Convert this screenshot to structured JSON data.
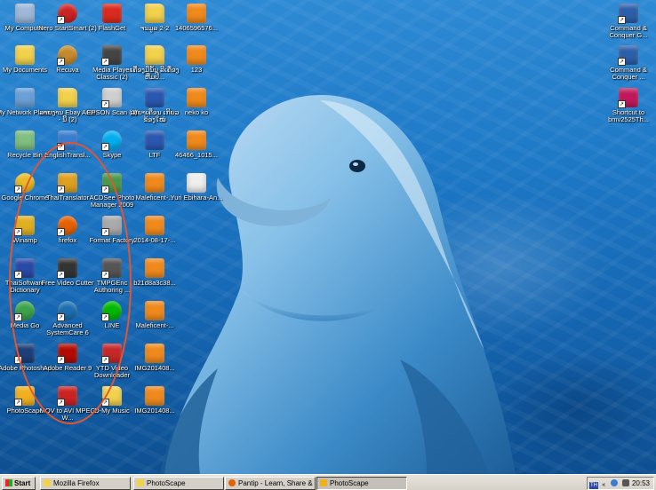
{
  "desktop": {
    "icons": [
      {
        "label": "My Computer",
        "icon": "my-computer-icon",
        "color": "#9fb8d8",
        "shortcut": false
      },
      {
        "label": "Nero StartSmart (2)",
        "icon": "nero-icon",
        "color": "#cc2222",
        "shortcut": true
      },
      {
        "label": "FlashGet",
        "icon": "flashget-icon",
        "color": "#d92b1e",
        "shortcut": false
      },
      {
        "label": "ຈນມູລ 2-2",
        "icon": "folder-icon",
        "color": "#f2d14b",
        "shortcut": false
      },
      {
        "label": "1406596576...",
        "icon": "photoscape-file-icon",
        "color": "#f08a1c",
        "shortcut": false
      },
      {
        "label": "Command & Conquer G...",
        "icon": "command-conquer-icon",
        "color": "#2c5faa",
        "shortcut": true
      },
      {
        "label": "My Documents",
        "icon": "my-documents-icon",
        "color": "#f2d14b",
        "shortcut": false
      },
      {
        "label": "Recuva",
        "icon": "recuva-icon",
        "color": "#c58a2a",
        "shortcut": true
      },
      {
        "label": "Media Player Classic (2)",
        "icon": "media-player-classic-icon",
        "color": "#444444",
        "shortcut": true
      },
      {
        "label": "ເຄື່ອງມືນັ້ນ ລີເຄື່ອງຫືມປີ...",
        "icon": "folder-icon",
        "color": "#f2d14b",
        "shortcut": false
      },
      {
        "label": "123",
        "icon": "photoscape-file-icon",
        "color": "#f08a1c",
        "shortcut": false
      },
      {
        "label": "Command & Conquer ...",
        "icon": "command-conquer-icon",
        "color": "#2c5faa",
        "shortcut": true
      },
      {
        "label": "My Network Places",
        "icon": "my-network-icon",
        "color": "#6aa0d8",
        "shortcut": false
      },
      {
        "label": "ລາຍງານ Ebay Auto - ນີ້ (2)",
        "icon": "folder-icon",
        "color": "#f2d14b",
        "shortcut": false
      },
      {
        "label": "EPSON Scan (2)",
        "icon": "epson-scan-icon",
        "color": "#cfcfcf",
        "shortcut": true
      },
      {
        "label": "ເສຍາເຄືອນ ເກີຍວຂ້ອງໃໝ່",
        "icon": "word-document-icon",
        "color": "#2a58b0",
        "shortcut": false
      },
      {
        "label": "neko ko",
        "icon": "photoscape-file-icon",
        "color": "#f08a1c",
        "shortcut": false
      },
      {
        "label": "Shortcut to bmv2525Th...",
        "icon": "game-shortcut-icon",
        "color": "#c2185b",
        "shortcut": true
      },
      {
        "label": "Recycle Bin",
        "icon": "recycle-bin-icon",
        "color": "#7fbf7f",
        "shortcut": false
      },
      {
        "label": "EnglishTransl...",
        "icon": "english-translator-icon",
        "color": "#3a7dd0",
        "shortcut": true
      },
      {
        "label": "Skype",
        "icon": "skype-icon",
        "color": "#00aff0",
        "shortcut": true
      },
      {
        "label": "LTF",
        "icon": "word-document-icon",
        "color": "#2a58b0",
        "shortcut": false
      },
      {
        "label": "46466_1015...",
        "icon": "photoscape-file-icon",
        "color": "#f08a1c",
        "shortcut": false
      },
      {
        "label": "Google Chrome",
        "icon": "chrome-icon",
        "color": "#e8b923",
        "shortcut": true
      },
      {
        "label": "ThaiTranslator",
        "icon": "thai-translator-icon",
        "color": "#e0a020",
        "shortcut": true
      },
      {
        "label": "ACDSee Photo Manager 2009",
        "icon": "acdsee-icon",
        "color": "#4a9a4a",
        "shortcut": true
      },
      {
        "label": "Maleficent-...",
        "icon": "photoscape-file-icon",
        "color": "#f08a1c",
        "shortcut": false
      },
      {
        "label": "Yuri Ebihara-An...",
        "icon": "text-file-icon",
        "color": "#eeeeee",
        "shortcut": false
      },
      {
        "label": "Winamp",
        "icon": "winamp-icon",
        "color": "#e0b020",
        "shortcut": true
      },
      {
        "label": "firefox",
        "icon": "firefox-icon",
        "color": "#e66000",
        "shortcut": true
      },
      {
        "label": "Format Factory",
        "icon": "format-factory-icon",
        "color": "#aaaaaa",
        "shortcut": true
      },
      {
        "label": "2014-08-17-...",
        "icon": "photoscape-file-icon",
        "color": "#f08a1c",
        "shortcut": false
      },
      {
        "label": "ThaiSoftware Dictionary",
        "icon": "thai-dictionary-icon",
        "color": "#2a4aa8",
        "shortcut": true
      },
      {
        "label": "Free Video Cutter",
        "icon": "video-cutter-icon",
        "color": "#333333",
        "shortcut": true
      },
      {
        "label": "TMPGEnc Authoring ...",
        "icon": "tmpgenc-icon",
        "color": "#555555",
        "shortcut": true
      },
      {
        "label": "b21d8a3c38...",
        "icon": "photoscape-file-icon",
        "color": "#f08a1c",
        "shortcut": false
      },
      {
        "label": "Media Go",
        "icon": "media-go-icon",
        "color": "#3aa34a",
        "shortcut": true
      },
      {
        "label": "Advanced SystemCare 6",
        "icon": "advanced-systemcare-icon",
        "color": "#1b6fb0",
        "shortcut": true
      },
      {
        "label": "LINE",
        "icon": "line-icon",
        "color": "#00b900",
        "shortcut": true
      },
      {
        "label": "Maleficent-...",
        "icon": "photoscape-file-icon",
        "color": "#f08a1c",
        "shortcut": false
      },
      {
        "label": "Adobe Photoshop",
        "icon": "photoshop-icon",
        "color": "#1c3f7a",
        "shortcut": true
      },
      {
        "label": "Adobe Reader 9",
        "icon": "adobe-reader-icon",
        "color": "#b30b00",
        "shortcut": true
      },
      {
        "label": "YTD Video Downloader",
        "icon": "ytd-icon",
        "color": "#c62828",
        "shortcut": true
      },
      {
        "label": "IMG201408...",
        "icon": "photoscape-file-icon",
        "color": "#f08a1c",
        "shortcut": false
      },
      {
        "label": "PhotoScape",
        "icon": "photoscape-icon",
        "color": "#f0b020",
        "shortcut": true
      },
      {
        "label": "MOV to AVI MPEG W...",
        "icon": "mov-to-avi-icon",
        "color": "#cc2222",
        "shortcut": true
      },
      {
        "label": "D-My Music",
        "icon": "folder-icon",
        "color": "#f2d14b",
        "shortcut": true
      },
      {
        "label": "IMG201408...",
        "icon": "photoscape-file-icon",
        "color": "#f08a1c",
        "shortcut": false
      }
    ]
  },
  "taskbar": {
    "start_label": "Start",
    "buttons": [
      {
        "label": "Mozilla Firefox",
        "icon": "folder-icon",
        "color": "#f2d14b",
        "active": false
      },
      {
        "label": "PhotoScape",
        "icon": "folder-icon",
        "color": "#f2d14b",
        "active": false
      },
      {
        "label": "Pantip - Learn, Share & ...",
        "icon": "firefox-icon",
        "color": "#e66000",
        "active": false
      },
      {
        "label": "PhotoScape",
        "icon": "photoscape-icon",
        "color": "#f0b020",
        "active": true
      }
    ],
    "tray": {
      "lang": "TH",
      "clock": "20:53"
    }
  }
}
